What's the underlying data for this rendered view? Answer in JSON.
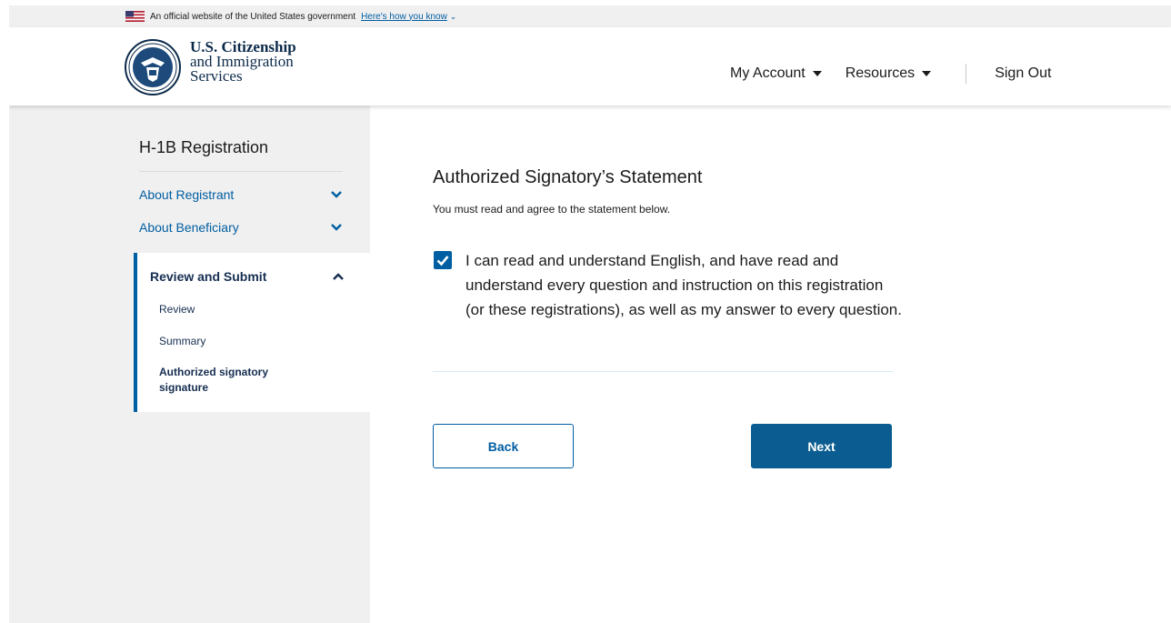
{
  "gov_banner": {
    "text": "An official website of the United States government",
    "link": "Here's how you know"
  },
  "header": {
    "logo_line1": "U.S. Citizenship",
    "logo_line2": "and Immigration",
    "logo_line3": "Services",
    "nav": {
      "my_account": "My Account",
      "resources": "Resources",
      "sign_out": "Sign Out"
    }
  },
  "sidebar": {
    "title": "H-1B Registration",
    "items": [
      {
        "label": "About Registrant"
      },
      {
        "label": "About Beneficiary"
      }
    ],
    "active_section": {
      "label": "Review and Submit",
      "sub_items": [
        {
          "label": "Review"
        },
        {
          "label": "Summary"
        },
        {
          "label": "Authorized signatory signature"
        }
      ]
    }
  },
  "main": {
    "heading": "Authorized Signatory’s Statement",
    "subtext": "You must read and agree to the statement below.",
    "checkbox_checked": true,
    "statement": "I can read and understand English, and have read and understand every question and instruction on this registration (or these registrations), as well as my answer to every question.",
    "back_label": "Back",
    "next_label": "Next"
  },
  "colors": {
    "primary": "#005ea2",
    "button_dark": "#0b5d91",
    "sidebar_bg": "#f0f0f0",
    "heading_navy": "#162e51"
  }
}
